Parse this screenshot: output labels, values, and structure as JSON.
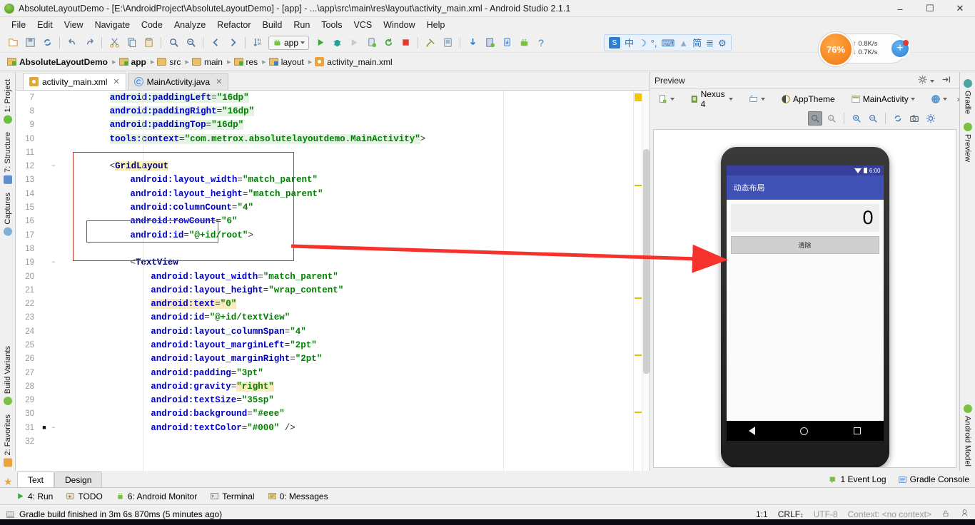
{
  "window": {
    "title": "AbsoluteLayoutDemo - [E:\\AndroidProject\\AbsoluteLayoutDemo] - [app] - ...\\app\\src\\main\\res\\layout\\activity_main.xml - Android Studio 2.1.1",
    "minimize": "–",
    "maximize": "☐",
    "close": "✕"
  },
  "menu": [
    "File",
    "Edit",
    "View",
    "Navigate",
    "Code",
    "Analyze",
    "Refactor",
    "Build",
    "Run",
    "Tools",
    "VCS",
    "Window",
    "Help"
  ],
  "toolbar": {
    "run_config": "app",
    "help_label": "?"
  },
  "ime": {
    "logo": "S",
    "mode": "中",
    "moon": "☽",
    "comma": "°,",
    "keyboard": "⌨",
    "user": "▲",
    "simplified": "简",
    "panel": "≣",
    "settings": "⚙"
  },
  "network": {
    "cpu_percent": "76%",
    "upload": "0.8K/s",
    "download": "0.7K/s",
    "plus": "+"
  },
  "breadcrumb": [
    {
      "label": "AbsoluteLayoutDemo",
      "icon": "folder-green-icon",
      "bold": true
    },
    {
      "label": "app",
      "icon": "folder-green-icon",
      "bold": true
    },
    {
      "label": "src",
      "icon": "folder-icon",
      "bold": false
    },
    {
      "label": "main",
      "icon": "folder-icon",
      "bold": false
    },
    {
      "label": "res",
      "icon": "folder-green-icon",
      "bold": false
    },
    {
      "label": "layout",
      "icon": "folder-blue-icon",
      "bold": false
    },
    {
      "label": "activity_main.xml",
      "icon": "xml-file-icon",
      "bold": false
    }
  ],
  "left_strip": [
    {
      "label": "1: Project",
      "icon": "project-icon"
    },
    {
      "label": "7: Structure",
      "icon": "structure-icon"
    },
    {
      "label": "Captures",
      "icon": "captures-icon"
    },
    {
      "label": "Build Variants",
      "icon": "build-variants-icon"
    },
    {
      "label": "2: Favorites",
      "icon": "favorites-icon"
    }
  ],
  "right_strip": [
    {
      "label": "Gradle",
      "icon": "gradle-icon"
    },
    {
      "label": "Preview",
      "icon": "preview-icon"
    },
    {
      "label": "Android Model",
      "icon": "android-model-icon"
    }
  ],
  "editor_tabs": [
    {
      "label": "activity_main.xml",
      "icon": "xml-file-icon",
      "active": true,
      "close": "✕"
    },
    {
      "label": "MainActivity.java",
      "icon": "java-class-icon",
      "active": false,
      "close": "✕"
    }
  ],
  "code": {
    "lines": [
      {
        "n": 7,
        "indent": 8,
        "parts": [
          {
            "t": "attr",
            "v": "android:paddingLeft",
            "hl": "green"
          },
          {
            "t": "punc",
            "v": "=",
            "hl": "green"
          },
          {
            "t": "val",
            "v": "\"16dp\"",
            "hl": "green"
          }
        ]
      },
      {
        "n": 8,
        "indent": 8,
        "parts": [
          {
            "t": "attr",
            "v": "android:paddingRight",
            "hl": "green"
          },
          {
            "t": "punc",
            "v": "=",
            "hl": "green"
          },
          {
            "t": "val",
            "v": "\"16dp\"",
            "hl": "green"
          }
        ]
      },
      {
        "n": 9,
        "indent": 8,
        "parts": [
          {
            "t": "attr",
            "v": "android:paddingTop",
            "hl": "green"
          },
          {
            "t": "punc",
            "v": "=",
            "hl": "green"
          },
          {
            "t": "val",
            "v": "\"16dp\"",
            "hl": "green"
          }
        ]
      },
      {
        "n": 10,
        "indent": 8,
        "parts": [
          {
            "t": "attr",
            "v": "tools:context",
            "hl": "green"
          },
          {
            "t": "punc",
            "v": "=",
            "hl": "green"
          },
          {
            "t": "val",
            "v": "\"com.metrox.absolutelayoutdemo.MainActivity\"",
            "hl": "green"
          },
          {
            "t": "punc",
            "v": ">"
          }
        ]
      },
      {
        "n": 11,
        "indent": 0,
        "parts": []
      },
      {
        "n": 12,
        "indent": 8,
        "fold": "−",
        "parts": [
          {
            "t": "punc",
            "v": "<"
          },
          {
            "t": "tag",
            "v": "GridLayout",
            "hl": "tag"
          }
        ]
      },
      {
        "n": 13,
        "indent": 12,
        "parts": [
          {
            "t": "attr",
            "v": "android:layout_width"
          },
          {
            "t": "punc",
            "v": "="
          },
          {
            "t": "val",
            "v": "\"match_parent\""
          }
        ]
      },
      {
        "n": 14,
        "indent": 12,
        "parts": [
          {
            "t": "attr",
            "v": "android:layout_height"
          },
          {
            "t": "punc",
            "v": "="
          },
          {
            "t": "val",
            "v": "\"match_parent\""
          }
        ]
      },
      {
        "n": 15,
        "indent": 12,
        "parts": [
          {
            "t": "attr",
            "v": "android:columnCount"
          },
          {
            "t": "punc",
            "v": "="
          },
          {
            "t": "val",
            "v": "\"4\""
          }
        ]
      },
      {
        "n": 16,
        "indent": 12,
        "parts": [
          {
            "t": "attr",
            "v": "android:rowCount"
          },
          {
            "t": "punc",
            "v": "="
          },
          {
            "t": "val",
            "v": "\"6\""
          }
        ]
      },
      {
        "n": 17,
        "indent": 12,
        "parts": [
          {
            "t": "attr",
            "v": "android:id"
          },
          {
            "t": "punc",
            "v": "="
          },
          {
            "t": "val",
            "v": "\"@+id/root\""
          },
          {
            "t": "punc",
            "v": ">"
          }
        ]
      },
      {
        "n": 18,
        "indent": 0,
        "parts": []
      },
      {
        "n": 19,
        "indent": 12,
        "fold": "−",
        "parts": [
          {
            "t": "punc",
            "v": "<"
          },
          {
            "t": "tag",
            "v": "TextView"
          }
        ]
      },
      {
        "n": 20,
        "indent": 16,
        "parts": [
          {
            "t": "attr",
            "v": "android:layout_width"
          },
          {
            "t": "punc",
            "v": "="
          },
          {
            "t": "val",
            "v": "\"match_parent\""
          }
        ]
      },
      {
        "n": 21,
        "indent": 16,
        "parts": [
          {
            "t": "attr",
            "v": "android:layout_height"
          },
          {
            "t": "punc",
            "v": "="
          },
          {
            "t": "val",
            "v": "\"wrap_content\""
          }
        ]
      },
      {
        "n": 22,
        "indent": 16,
        "parts": [
          {
            "t": "attr",
            "v": "android:text",
            "hl": "yellow"
          },
          {
            "t": "punc",
            "v": "=",
            "hl": "yellow"
          },
          {
            "t": "val",
            "v": "\"0\"",
            "hl": "yellow"
          }
        ]
      },
      {
        "n": 23,
        "indent": 16,
        "parts": [
          {
            "t": "attr",
            "v": "android:id"
          },
          {
            "t": "punc",
            "v": "="
          },
          {
            "t": "val",
            "v": "\"@+id/textView\""
          }
        ]
      },
      {
        "n": 24,
        "indent": 16,
        "parts": [
          {
            "t": "attr",
            "v": "android:layout_columnSpan"
          },
          {
            "t": "punc",
            "v": "="
          },
          {
            "t": "val",
            "v": "\"4\""
          }
        ]
      },
      {
        "n": 25,
        "indent": 16,
        "parts": [
          {
            "t": "attr",
            "v": "android:layout_marginLeft"
          },
          {
            "t": "punc",
            "v": "="
          },
          {
            "t": "val",
            "v": "\"2pt\""
          }
        ]
      },
      {
        "n": 26,
        "indent": 16,
        "parts": [
          {
            "t": "attr",
            "v": "android:layout_marginRight"
          },
          {
            "t": "punc",
            "v": "="
          },
          {
            "t": "val",
            "v": "\"2pt\""
          }
        ]
      },
      {
        "n": 27,
        "indent": 16,
        "parts": [
          {
            "t": "attr",
            "v": "android:padding"
          },
          {
            "t": "punc",
            "v": "="
          },
          {
            "t": "val",
            "v": "\"3pt\""
          }
        ]
      },
      {
        "n": 28,
        "indent": 16,
        "parts": [
          {
            "t": "attr",
            "v": "android:gravity"
          },
          {
            "t": "punc",
            "v": "="
          },
          {
            "t": "val",
            "v": "\"right\"",
            "hl": "yellow"
          }
        ]
      },
      {
        "n": 29,
        "indent": 16,
        "parts": [
          {
            "t": "attr",
            "v": "android:textSize"
          },
          {
            "t": "punc",
            "v": "="
          },
          {
            "t": "val",
            "v": "\"35sp\""
          }
        ]
      },
      {
        "n": 30,
        "indent": 16,
        "parts": [
          {
            "t": "attr",
            "v": "android:background"
          },
          {
            "t": "punc",
            "v": "="
          },
          {
            "t": "val",
            "v": "\"#eee\""
          }
        ]
      },
      {
        "n": 31,
        "indent": 16,
        "fold": "−",
        "bp": true,
        "parts": [
          {
            "t": "attr",
            "v": "android:textColor"
          },
          {
            "t": "punc",
            "v": "="
          },
          {
            "t": "val",
            "v": "\"#000\""
          },
          {
            "t": "punc",
            "v": " />"
          }
        ]
      },
      {
        "n": 32,
        "indent": 0,
        "parts": []
      }
    ]
  },
  "annotation": {
    "box_color": "#c0392b",
    "arrow_color": "#f5322b",
    "note": "android:id=\"@+id/root\" highlighted and pointed at preview"
  },
  "preview": {
    "panel_title": "Preview",
    "settings_icon": "gear-icon",
    "hide_icon": "hide-panel-icon",
    "toolbar": [
      {
        "label": "",
        "icon": "device-config-icon",
        "caret": true
      },
      {
        "label": "Nexus 4",
        "icon": "device-icon",
        "caret": true
      },
      {
        "label": "",
        "icon": "orientation-icon",
        "caret": true
      },
      {
        "label": "AppTheme",
        "icon": "theme-icon",
        "caret": false
      },
      {
        "label": "MainActivity",
        "icon": "activity-icon",
        "caret": true
      },
      {
        "label": "",
        "icon": "locale-globe-icon",
        "caret": true
      },
      {
        "label": "»",
        "icon": "overflow-icon",
        "caret": false
      }
    ],
    "zoom_buttons": [
      "zoom-fit-icon",
      "zoom-actual-icon",
      "zoom-in-icon",
      "zoom-out-icon",
      "refresh-icon",
      "screenshot-icon",
      "preview-settings-icon"
    ],
    "device": {
      "status_time": "6:00",
      "wifi_icon": "wifi-icon",
      "battery_icon": "battery-icon",
      "app_title": "动态布局",
      "result_value": "0",
      "clear_button": "清除",
      "nav_back": "back-icon",
      "nav_home": "home-icon",
      "nav_recents": "recents-icon"
    }
  },
  "bottom": {
    "editor_tabs": [
      {
        "label": "Text",
        "active": true
      },
      {
        "label": "Design",
        "active": false
      }
    ],
    "tool_windows": [
      {
        "label": "4: Run",
        "icon": "run-icon",
        "mnemonic": "4"
      },
      {
        "label": "TODO",
        "icon": "todo-icon",
        "mnemonic": ""
      },
      {
        "label": "6: Android Monitor",
        "icon": "android-monitor-icon",
        "mnemonic": "6"
      },
      {
        "label": "Terminal",
        "icon": "terminal-icon",
        "mnemonic": ""
      },
      {
        "label": "0: Messages",
        "icon": "messages-icon",
        "mnemonic": "0"
      }
    ],
    "status_message": "Gradle build finished in 3m 6s 870ms (5 minutes ago)",
    "status_icon": "build-icon",
    "right_items": [
      {
        "label": "1 Event Log",
        "icon": "event-log-icon"
      },
      {
        "label": "Gradle Console",
        "icon": "gradle-console-icon"
      }
    ],
    "caret_position": "1:1",
    "line_separator": "CRLF",
    "encoding": "UTF-8",
    "context": "Context: <no context>",
    "lock_icon": "readonly-lock-icon",
    "inspection_icon": "inspection-icon"
  }
}
